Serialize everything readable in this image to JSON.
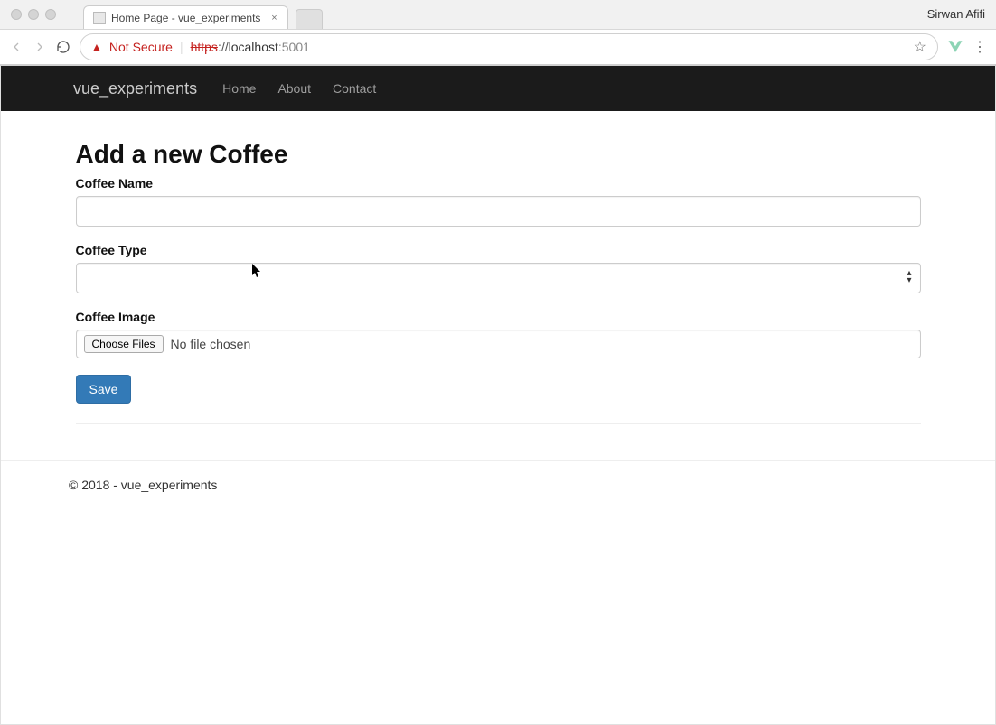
{
  "browser": {
    "tab_title": "Home Page - vue_experiments",
    "user_label": "Sirwan Afifi",
    "not_secure": "Not Secure",
    "url": {
      "protocol": "https",
      "host": "localhost",
      "port": ":5001"
    }
  },
  "navbar": {
    "brand": "vue_experiments",
    "links": [
      "Home",
      "About",
      "Contact"
    ]
  },
  "form": {
    "title": "Add a new Coffee",
    "name_label": "Coffee Name",
    "type_label": "Coffee Type",
    "image_label": "Coffee Image",
    "file_button": "Choose Files",
    "file_status": "No file chosen",
    "save_label": "Save"
  },
  "footer": {
    "text": "© 2018 - vue_experiments"
  }
}
